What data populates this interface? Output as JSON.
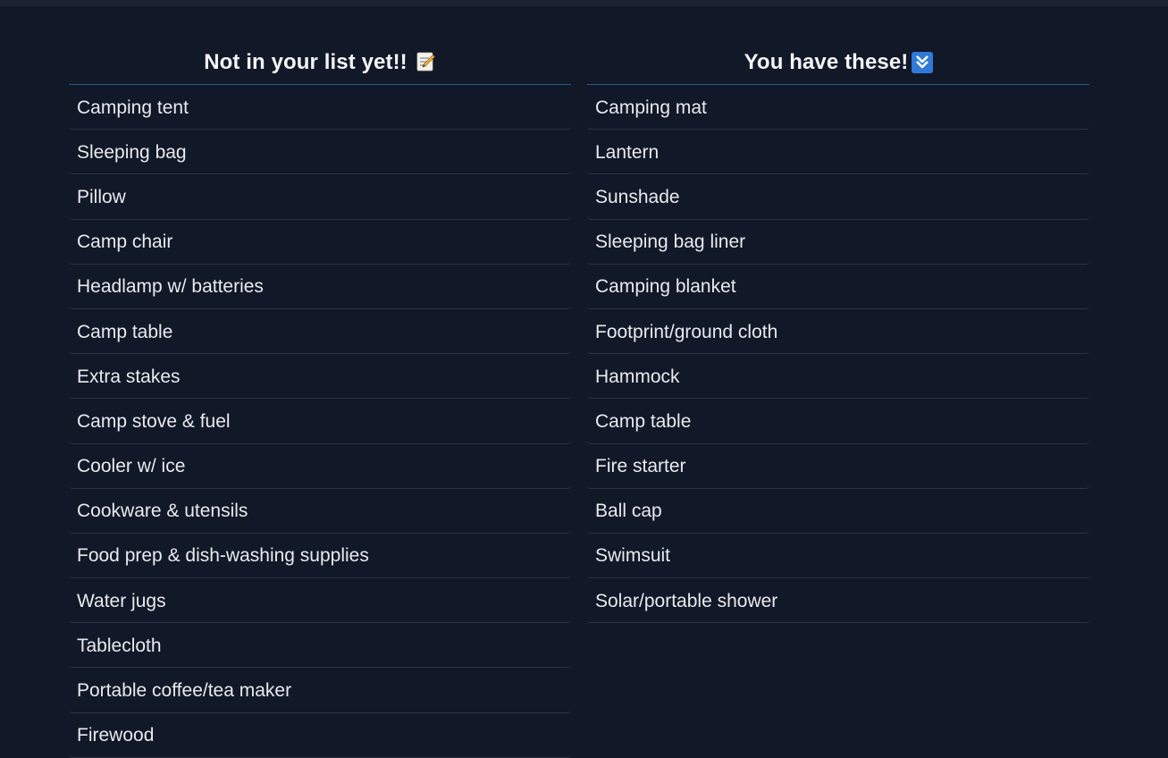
{
  "colors": {
    "background": "#111827",
    "text": "#e8eaee",
    "title_underline": "#2e5a86",
    "row_divider": "#2b3442"
  },
  "not_in_list": {
    "title": "Not in your list yet!!",
    "icon": "memo-icon",
    "items": [
      "Camping tent",
      "Sleeping bag",
      "Pillow",
      "Camp chair",
      "Headlamp w/ batteries",
      "Camp table",
      "Extra stakes",
      "Camp stove & fuel",
      "Cooler w/ ice",
      "Cookware & utensils",
      "Food prep & dish-washing supplies",
      "Water jugs",
      "Tablecloth",
      "Portable coffee/tea maker",
      "Firewood"
    ]
  },
  "you_have": {
    "title": "You have these!",
    "icon": "double-down-arrow-icon",
    "items": [
      "Camping mat",
      "Lantern",
      "Sunshade",
      "Sleeping bag liner",
      "Camping blanket",
      "Footprint/ground cloth",
      "Hammock",
      "Camp table",
      "Fire starter",
      "Ball cap",
      "Swimsuit",
      "Solar/portable shower"
    ]
  }
}
